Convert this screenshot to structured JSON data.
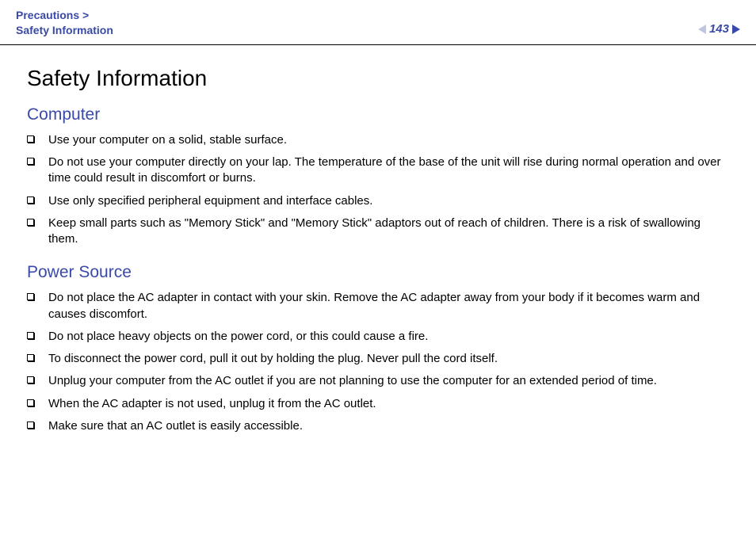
{
  "header": {
    "breadcrumb_line1": "Precautions >",
    "breadcrumb_line2": "Safety Information",
    "page_number": "143"
  },
  "page": {
    "title": "Safety Information",
    "sections": [
      {
        "heading": "Computer",
        "items": [
          "Use your computer on a solid, stable surface.",
          "Do not use your computer directly on your lap. The temperature of the base of the unit will rise during normal operation and over time could result in discomfort or burns.",
          "Use only specified peripheral equipment and interface cables.",
          "Keep small parts such as \"Memory Stick\" and \"Memory Stick\" adaptors out of reach of children. There is a risk of swallowing them."
        ]
      },
      {
        "heading": "Power Source",
        "items": [
          "Do not place the AC adapter in contact with your skin. Remove the AC adapter away from your body if it becomes warm and causes discomfort.",
          "Do not place heavy objects on the power cord, or this could cause a fire.",
          "To disconnect the power cord, pull it out by holding the plug. Never pull the cord itself.",
          "Unplug your computer from the AC outlet if you are not planning to use the computer for an extended period of time.",
          "When the AC adapter is not used, unplug it from the AC outlet.",
          "Make sure that an AC outlet is easily accessible."
        ]
      }
    ]
  }
}
